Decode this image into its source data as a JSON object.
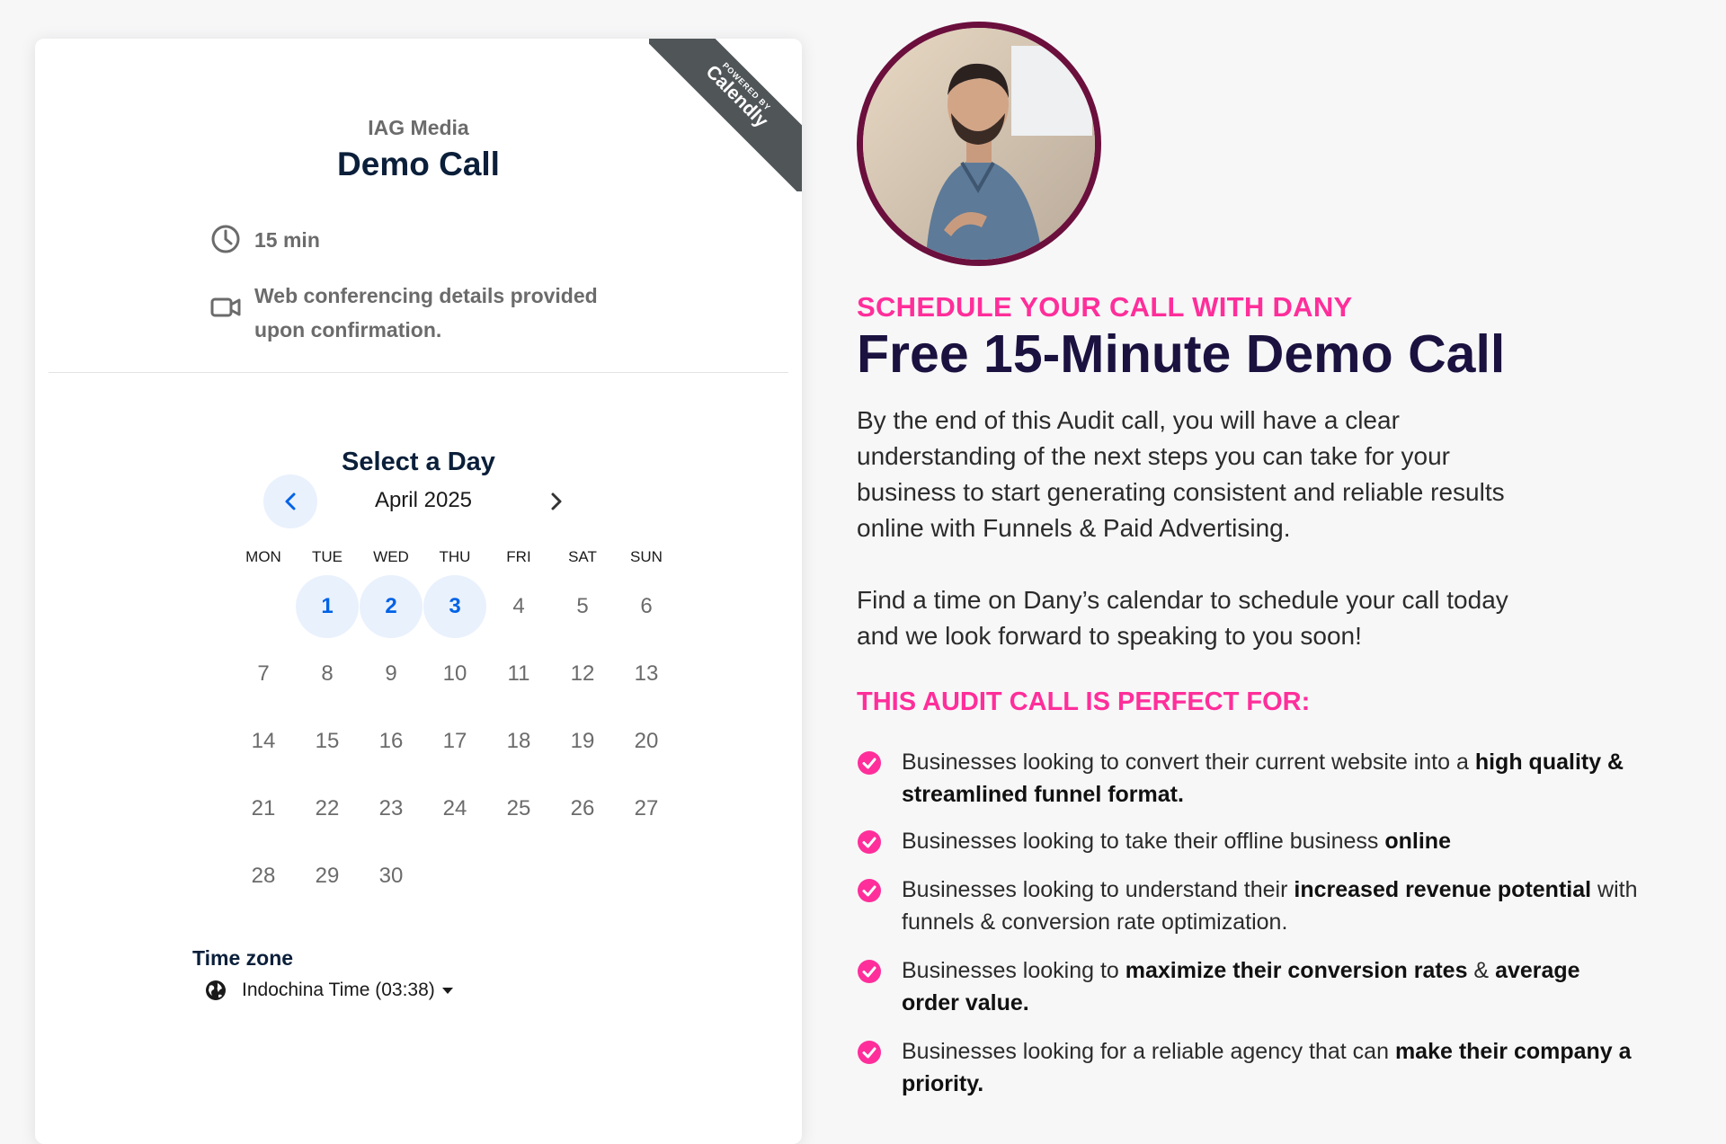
{
  "card": {
    "ribbon_small": "POWERED BY",
    "ribbon_brand": "Calendly",
    "organization": "IAG Media",
    "event_name": "Demo Call",
    "duration": "15 min",
    "location_line1": "Web conferencing details provided",
    "location_line2": "upon confirmation.",
    "select_day_label": "Select a Day",
    "month_label": "April 2025",
    "weekdays": [
      "MON",
      "TUE",
      "WED",
      "THU",
      "FRI",
      "SAT",
      "SUN"
    ],
    "days": [
      "1",
      "2",
      "3",
      "4",
      "5",
      "6",
      "7",
      "8",
      "9",
      "10",
      "11",
      "12",
      "13",
      "14",
      "15",
      "16",
      "17",
      "18",
      "19",
      "20",
      "21",
      "22",
      "23",
      "24",
      "25",
      "26",
      "27",
      "28",
      "29",
      "30"
    ],
    "available_days": [
      "1",
      "2",
      "3"
    ],
    "timezone_label": "Time zone",
    "timezone_value": "Indochina Time (03:38)",
    "accent_color": "#0062e6"
  },
  "right": {
    "kicker": "SCHEDULE YOUR CALL WITH DANY",
    "headline": "Free 15-Minute Demo Call",
    "para1_lines": [
      "By the end of this Audit call, you will have a clear",
      "understanding of the next steps you can take for your",
      "business to start generating consistent and reliable results",
      "online with Funnels & Paid Advertising."
    ],
    "para2_lines": [
      "Find a time on Dany’s calendar to schedule your call today",
      "and we look forward to speaking to you soon!"
    ],
    "list_title": "THIS AUDIT CALL IS PERFECT FOR:",
    "bullets": [
      {
        "pre": "Businesses looking to convert their current website into a",
        "bold": "high quality & streamlined funnel format.",
        "post": ""
      },
      {
        "pre": "Businesses looking to take their offline business",
        "bold": "online",
        "post": ""
      },
      {
        "pre": "Businesses looking to understand their",
        "bold": "increased revenue potential",
        "post": "with funnels & conversion rate optimization."
      },
      {
        "pre": "Businesses looking to",
        "bold": "maximize their conversion rates",
        "post": "& ",
        "bold2": "average order value."
      },
      {
        "pre": "Businesses looking for a reliable agency that can",
        "bold": "make their company a priority.",
        "post": ""
      }
    ],
    "accent_pink": "#ff2e9a",
    "headline_color": "#1b1240"
  }
}
